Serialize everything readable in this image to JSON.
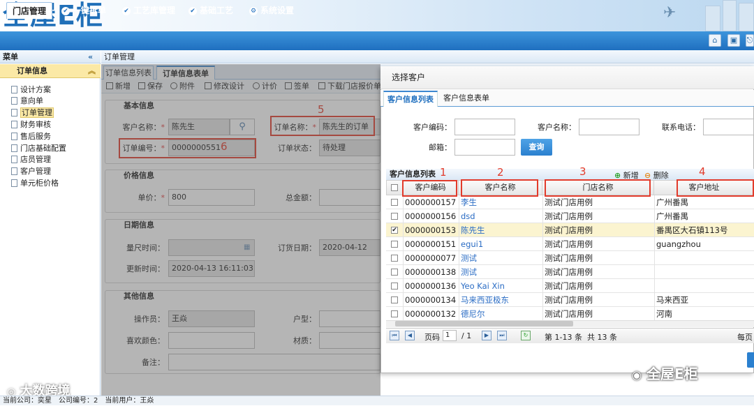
{
  "header": {
    "logo_text": "全屋E柜"
  },
  "menu": {
    "tabs": [
      "门店管理",
      "一键拆单",
      "工艺库管理",
      "基础工艺",
      "系统设置"
    ]
  },
  "sidebar": {
    "title": "菜单",
    "collapse": "«",
    "group": "订单信息",
    "group_toggle": "︽",
    "items": [
      "设计方案",
      "意向单",
      "订单管理",
      "财务审核",
      "售后服务",
      "门店基础配置",
      "店员管理",
      "客户管理",
      "单元柜价格"
    ]
  },
  "breadcrumb": "订单管理",
  "form_tabs": [
    "订单信息列表",
    "订单信息表单"
  ],
  "toolbar": [
    "新增",
    "保存",
    "附件",
    "修改设计",
    "计价",
    "签单",
    "下载门店报价单"
  ],
  "form": {
    "sec_basic": "基本信息",
    "sec_price": "价格信息",
    "sec_date": "日期信息",
    "sec_other": "其他信息",
    "customer_label": "客户名称：",
    "customer_value": "陈先生",
    "order_name_label": "订单名称：",
    "order_name_value": "陈先生的订单",
    "order_no_label": "订单编号：",
    "order_no_value": "0000000551",
    "order_status_label": "订单状态：",
    "order_status_value": "待处理",
    "unit_price_label": "单价：",
    "unit_price_value": "800",
    "total_label": "总金额：",
    "measure_time_label": "量尺时间：",
    "order_date_label": "订货日期：",
    "order_date_value": "2020-04-12",
    "update_time_label": "更新时间：",
    "update_time_value": "2020-04-13 16:11:03",
    "operator_label": "操作员：",
    "operator_value": "王焱",
    "house_label": "户型：",
    "color_label": "喜欢颜色：",
    "material_label": "材质：",
    "note_label": "备注：",
    "req": "*"
  },
  "annotations": [
    "1",
    "2",
    "3",
    "4",
    "5",
    "6"
  ],
  "dialog": {
    "title": "选择客户",
    "tabs": [
      "客户信息列表",
      "客户信息表单"
    ],
    "search": {
      "code_label": "客户编码：",
      "name_label": "客户名称：",
      "phone_label": "联系电话：",
      "email_label": "邮箱：",
      "button": "查询"
    },
    "grid_title": "客户信息列表",
    "add": "新增",
    "delete": "删除",
    "columns": [
      "客户编码",
      "客户名称",
      "门店名称",
      "客户地址"
    ],
    "rows": [
      {
        "code": "0000000157",
        "name": "李生",
        "store": "测试门店用例",
        "addr": "广州番禺",
        "checked": false
      },
      {
        "code": "0000000156",
        "name": "dsd",
        "store": "测试门店用例",
        "addr": "广州番禺",
        "checked": false
      },
      {
        "code": "0000000153",
        "name": "陈先生",
        "store": "测试门店用例",
        "addr": "番禺区大石镇113号",
        "checked": true
      },
      {
        "code": "0000000151",
        "name": "egui1",
        "store": "测试门店用例",
        "addr": "guangzhou",
        "checked": false
      },
      {
        "code": "0000000077",
        "name": "测试",
        "store": "测试门店用例",
        "addr": "",
        "checked": false
      },
      {
        "code": "0000000138",
        "name": "测试",
        "store": "测试门店用例",
        "addr": "",
        "checked": false
      },
      {
        "code": "0000000136",
        "name": "Yeo Kai Xin",
        "store": "测试门店用例",
        "addr": "",
        "checked": false
      },
      {
        "code": "0000000134",
        "name": "马来西亚极东",
        "store": "测试门店用例",
        "addr": "马来西亚",
        "checked": false
      },
      {
        "code": "0000000132",
        "name": "德尼尔",
        "store": "测试门店用例",
        "addr": "河南",
        "checked": false
      }
    ],
    "pager": {
      "page_label": "页码",
      "page": "1",
      "total_pages": "/ 1",
      "range": "第 1-13 条  共 13 条",
      "per_page": "每页"
    }
  },
  "footer": "当前公司：奕星　公司编号：2　当前用户：王焱",
  "watermark_right": "全屋E柜",
  "watermark_left": "大数跨境"
}
